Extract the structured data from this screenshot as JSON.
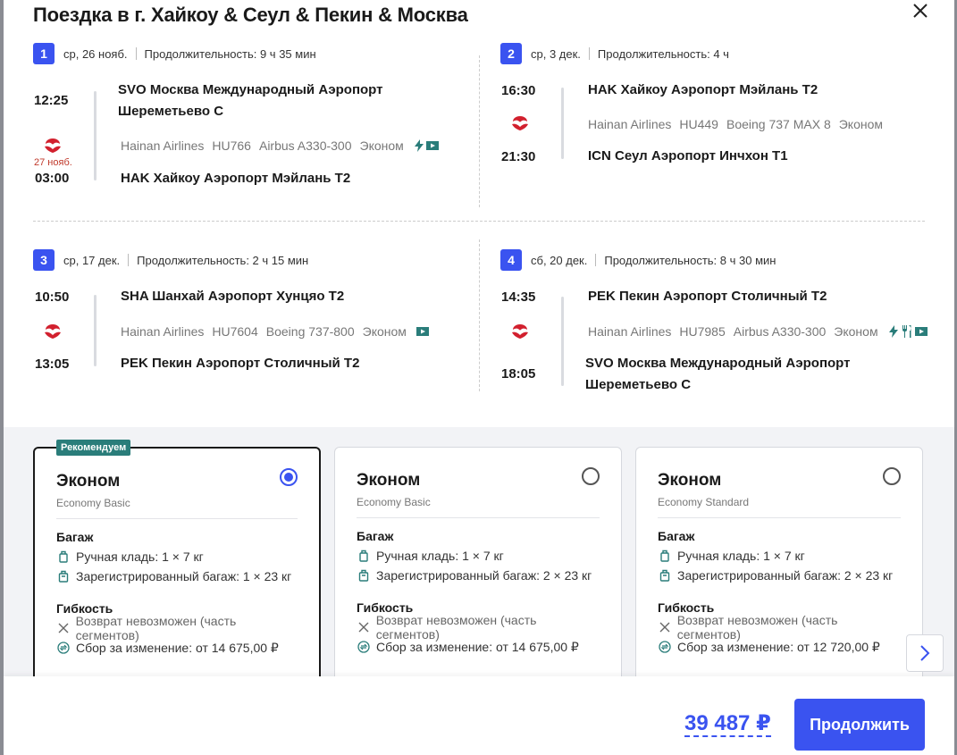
{
  "title": "Поездка в г. Хайкоу & Сеул & Пекин & Москва",
  "segments": [
    {
      "num": "1",
      "date": "ср, 26 нояб.",
      "duration": "Продолжительность: 9 ч 35 мин",
      "dep_time": "12:25",
      "dep_airport_line1": "SVO Москва Международный Аэропорт",
      "dep_airport_line2": "Шереметьево C",
      "next_day": "27 нояб.",
      "arr_time": "03:00",
      "arr_airport": "HAK Хайкоу Аэропорт Мэйлань T2",
      "airline": "Hainan Airlines",
      "flight": "HU766",
      "aircraft": "Airbus A330-300",
      "cabin": "Эконом"
    },
    {
      "num": "2",
      "date": "ср, 3 дек.",
      "duration": "Продолжительность: 4 ч",
      "dep_time": "16:30",
      "dep_airport": "HAK Хайкоу Аэропорт Мэйлань T2",
      "arr_time": "21:30",
      "arr_airport": "ICN Сеул Аэропорт Инчхон T1",
      "airline": "Hainan Airlines",
      "flight": "HU449",
      "aircraft": "Boeing 737 MAX 8",
      "cabin": "Эконом"
    },
    {
      "num": "3",
      "date": "ср, 17 дек.",
      "duration": "Продолжительность: 2 ч 15 мин",
      "dep_time": "10:50",
      "dep_airport": "SHA Шанхай Аэропорт Хунцяо T2",
      "arr_time": "13:05",
      "arr_airport": "PEK Пекин Аэропорт Столичный T2",
      "airline": "Hainan Airlines",
      "flight": "HU7604",
      "aircraft": "Boeing 737-800",
      "cabin": "Эконом"
    },
    {
      "num": "4",
      "date": "сб, 20 дек.",
      "duration": "Продолжительность: 8 ч 30 мин",
      "dep_time": "14:35",
      "dep_airport": "PEK Пекин Аэропорт Столичный T2",
      "arr_time": "18:05",
      "arr_airport_line1": "SVO Москва Международный Аэропорт",
      "arr_airport_line2": "Шереметьево C",
      "airline": "Hainan Airlines",
      "flight": "HU7985",
      "aircraft": "Airbus A330-300",
      "cabin": "Эконом"
    }
  ],
  "fares": [
    {
      "badge": "Рекомендуем",
      "name": "Эконом",
      "sub": "Economy Basic",
      "selected": true,
      "baggage_title": "Багаж",
      "carry_on": "Ручная кладь: 1 × 7 кг",
      "checked": "Зарегистрированный багаж: 1 × 23 кг",
      "flex_title": "Гибкость",
      "refund": "Возврат невозможен (часть сегментов)",
      "change": "Сбор за изменение: от 14 675,00 ₽"
    },
    {
      "name": "Эконом",
      "sub": "Economy Basic",
      "selected": false,
      "baggage_title": "Багаж",
      "carry_on": "Ручная кладь: 1 × 7 кг",
      "checked": "Зарегистрированный багаж: 2 × 23 кг",
      "flex_title": "Гибкость",
      "refund": "Возврат невозможен (часть сегментов)",
      "change": "Сбор за изменение: от 14 675,00 ₽"
    },
    {
      "name": "Эконом",
      "sub": "Economy Standard",
      "selected": false,
      "baggage_title": "Багаж",
      "carry_on": "Ручная кладь: 1 × 7 кг",
      "checked": "Зарегистрированный багаж: 2 × 23 кг",
      "flex_title": "Гибкость",
      "refund": "Возврат невозможен (часть сегментов)",
      "change": "Сбор за изменение: от 12 720,00 ₽"
    }
  ],
  "footer": {
    "price": "39 487 ₽",
    "continue_label": "Продолжить"
  },
  "colors": {
    "accent": "#3a53f0",
    "badge": "#2a7d7a",
    "airline_logo": "#d2202e"
  }
}
